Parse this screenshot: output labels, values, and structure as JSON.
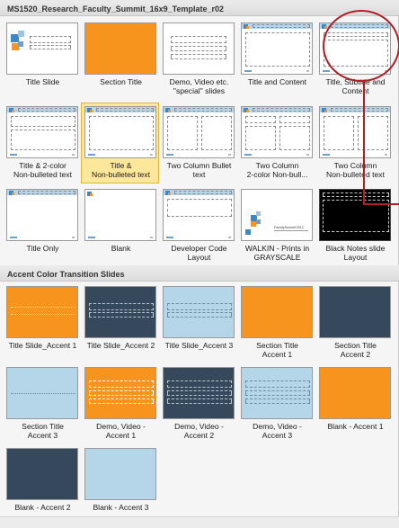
{
  "gallery": {
    "title": "MS1520_Research_Faculty_Summit_16x9_Template_r02",
    "section2_title": "Accent Color Transition Slides",
    "layouts": [
      {
        "label": "Title Slide"
      },
      {
        "label": "Section Title"
      },
      {
        "label": "Demo, Video etc.\n\"special\" slides"
      },
      {
        "label": "Title and Content"
      },
      {
        "label": "Title, Subtitle and\nContent"
      },
      {
        "label": "Title & 2-color\nNon-bulleted text"
      },
      {
        "label": "Title &\nNon-bulleted text"
      },
      {
        "label": "Two Column Bullet\ntext"
      },
      {
        "label": "Two Column\n2-color Non-bull..."
      },
      {
        "label": "Two Column\nNon-bulleted text"
      },
      {
        "label": "Title Only"
      },
      {
        "label": "Blank"
      },
      {
        "label": "Developer Code\nLayout"
      },
      {
        "label": "WALKIN - Prints in\nGRAYSCALE"
      },
      {
        "label": "Black Notes slide\nLayout"
      }
    ],
    "accent_layouts": [
      {
        "label": "Title Slide_Accent 1"
      },
      {
        "label": "Title Slide_Accent 2"
      },
      {
        "label": "Title Slide_Accent 3"
      },
      {
        "label": "Section Title\nAccent 1"
      },
      {
        "label": "Section Title\nAccent 2"
      },
      {
        "label": "Section Title\nAccent 3"
      },
      {
        "label": "Demo, Video -\nAccent 1"
      },
      {
        "label": "Demo, Video -\nAccent 2"
      },
      {
        "label": "Demo, Video -\nAccent 3"
      },
      {
        "label": "Blank - Accent 1"
      },
      {
        "label": "Blank - Accent 2"
      },
      {
        "label": "Blank - Accent 3"
      }
    ],
    "walkin_logo_text": "FacultySummit 2012"
  },
  "colors": {
    "orange": "#f7941d",
    "navy": "#36495c",
    "lightblue": "#b5d6e8",
    "selected": "#fde79a",
    "annotation_red": "#b01e26"
  }
}
